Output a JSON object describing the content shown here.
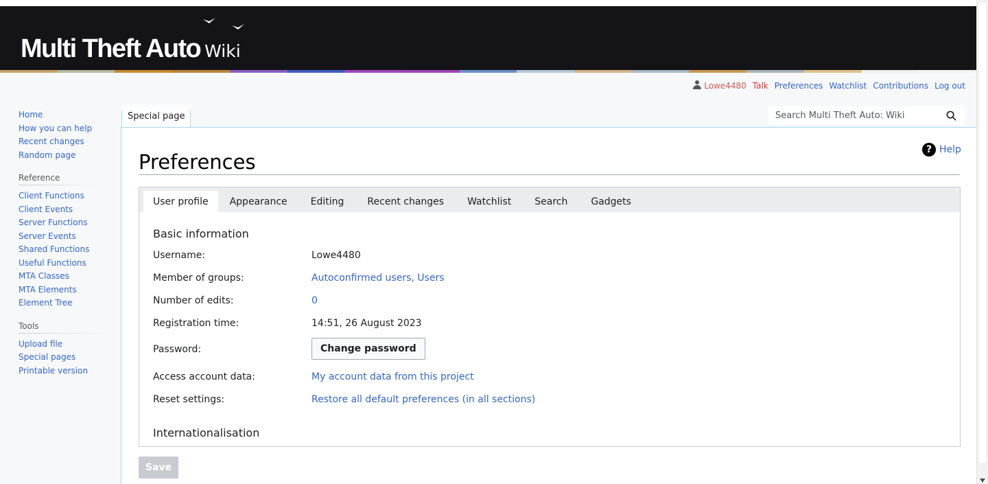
{
  "header": {
    "logo_main": "Multi Theft Auto",
    "logo_wiki": "Wiki",
    "colorbar": [
      "#c9a36a",
      "#b7b8a0",
      "#c68a2e",
      "#b9853a",
      "#8b5ec0",
      "#3f5cc0",
      "#a047b8",
      "#9d46b4",
      "#6c8fc8",
      "#b1c8d6",
      "#d5b48c",
      "#a8b8c7",
      "#c89a56",
      "#aab4b8",
      "#e0c28c",
      "#f0f0f0",
      "#f4f4f4"
    ]
  },
  "personal": {
    "username": "Lowe4480",
    "talk": "Talk",
    "preferences": "Preferences",
    "watchlist": "Watchlist",
    "contributions": "Contributions",
    "logout": "Log out"
  },
  "sidebar": {
    "nav": [
      "Home",
      "How you can help",
      "Recent changes",
      "Random page"
    ],
    "reference_heading": "Reference",
    "reference": [
      "Client Functions",
      "Client Events",
      "Server Functions",
      "Server Events",
      "Shared Functions",
      "Useful Functions",
      "MTA Classes",
      "MTA Elements",
      "Element Tree"
    ],
    "tools_heading": "Tools",
    "tools": [
      "Upload file",
      "Special pages",
      "Printable version"
    ]
  },
  "page_tab": "Special page",
  "search": {
    "placeholder": "Search Multi Theft Auto: Wiki"
  },
  "page": {
    "title": "Preferences",
    "help": "Help"
  },
  "prefs": {
    "tabs": [
      "User profile",
      "Appearance",
      "Editing",
      "Recent changes",
      "Watchlist",
      "Search",
      "Gadgets"
    ],
    "active_tab": "User profile",
    "basic_heading": "Basic information",
    "rows": {
      "username_label": "Username:",
      "username_value": "Lowe4480",
      "groups_label": "Member of groups:",
      "groups_value": "Autoconfirmed users, Users",
      "edits_label": "Number of edits:",
      "edits_value": "0",
      "regtime_label": "Registration time:",
      "regtime_value": "14:51, 26 August 2023",
      "password_label": "Password:",
      "password_button": "Change password",
      "access_label": "Access account data:",
      "access_value": "My account data from this project",
      "reset_label": "Reset settings:",
      "reset_value": "Restore all default preferences (in all sections)"
    },
    "intl_heading": "Internationalisation",
    "save": "Save"
  }
}
